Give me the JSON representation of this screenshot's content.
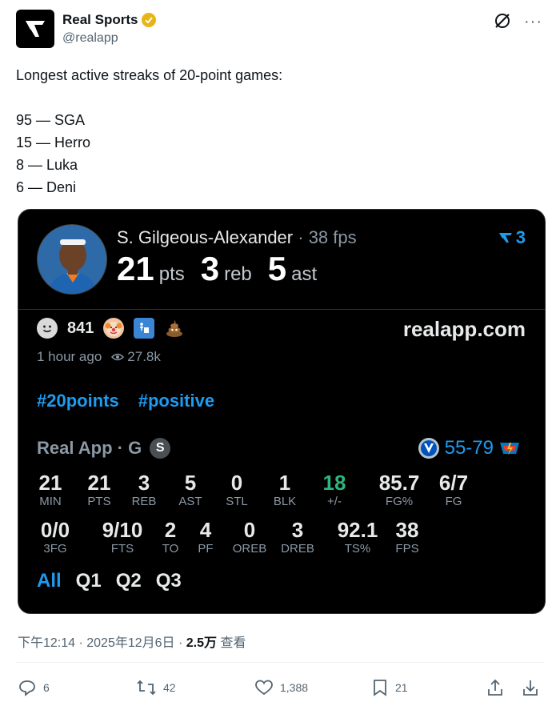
{
  "account": {
    "name": "Real Sports",
    "handle": "@realapp"
  },
  "tweet": {
    "text": "Longest active streaks of 20-point games:\n\n95 — SGA\n15 — Herro\n8 — Luka\n6 — Deni"
  },
  "card": {
    "player_name": "S. Gilgeous-Alexander",
    "player_meta": "· 38 fps",
    "stats": [
      {
        "value": "21",
        "unit": "pts"
      },
      {
        "value": "3",
        "unit": "reb"
      },
      {
        "value": "5",
        "unit": "ast"
      }
    ],
    "badge_count": "3",
    "reaction_count": "841",
    "site": "realapp.com",
    "time_ago": "1 hour ago",
    "views": "27.8k",
    "hashtags": [
      "#20points",
      "#positive"
    ],
    "source": "Real App · G",
    "source_badge": "S",
    "score": "55-79",
    "box_row1": [
      {
        "value": "21",
        "label": "MIN"
      },
      {
        "value": "21",
        "label": "PTS"
      },
      {
        "value": "3",
        "label": "REB"
      },
      {
        "value": "5",
        "label": "AST"
      },
      {
        "value": "0",
        "label": "STL"
      },
      {
        "value": "1",
        "label": "BLK"
      },
      {
        "value": "18",
        "label": "+/-"
      },
      {
        "value": "85.7",
        "label": "FG%"
      },
      {
        "value": "6/7",
        "label": "FG"
      }
    ],
    "box_row2": [
      {
        "value": "0/0",
        "label": "3FG"
      },
      {
        "value": "9/10",
        "label": "FTS"
      },
      {
        "value": "2",
        "label": "TO"
      },
      {
        "value": "4",
        "label": "PF"
      },
      {
        "value": "0",
        "label": "OREB"
      },
      {
        "value": "3",
        "label": "DREB"
      },
      {
        "value": "92.1",
        "label": "TS%"
      },
      {
        "value": "38",
        "label": "FPS"
      }
    ],
    "quarters": [
      "All",
      "Q1",
      "Q2",
      "Q3"
    ],
    "colors": {
      "accent": "#1d9bf0",
      "positive": "#2cb67d"
    }
  },
  "timestamp": {
    "text": "下午12:14 · 2025年12月6日 · ",
    "views": "2.5万",
    "views_label": " 查看"
  },
  "actions": {
    "replies": "6",
    "reposts": "42",
    "likes": "1,388",
    "bookmarks": "21"
  },
  "icons": [
    "verified-badge-icon",
    "grok-icon",
    "more-icon",
    "reply-icon",
    "repost-icon",
    "like-icon",
    "bookmark-icon",
    "share-icon",
    "download-icon"
  ]
}
